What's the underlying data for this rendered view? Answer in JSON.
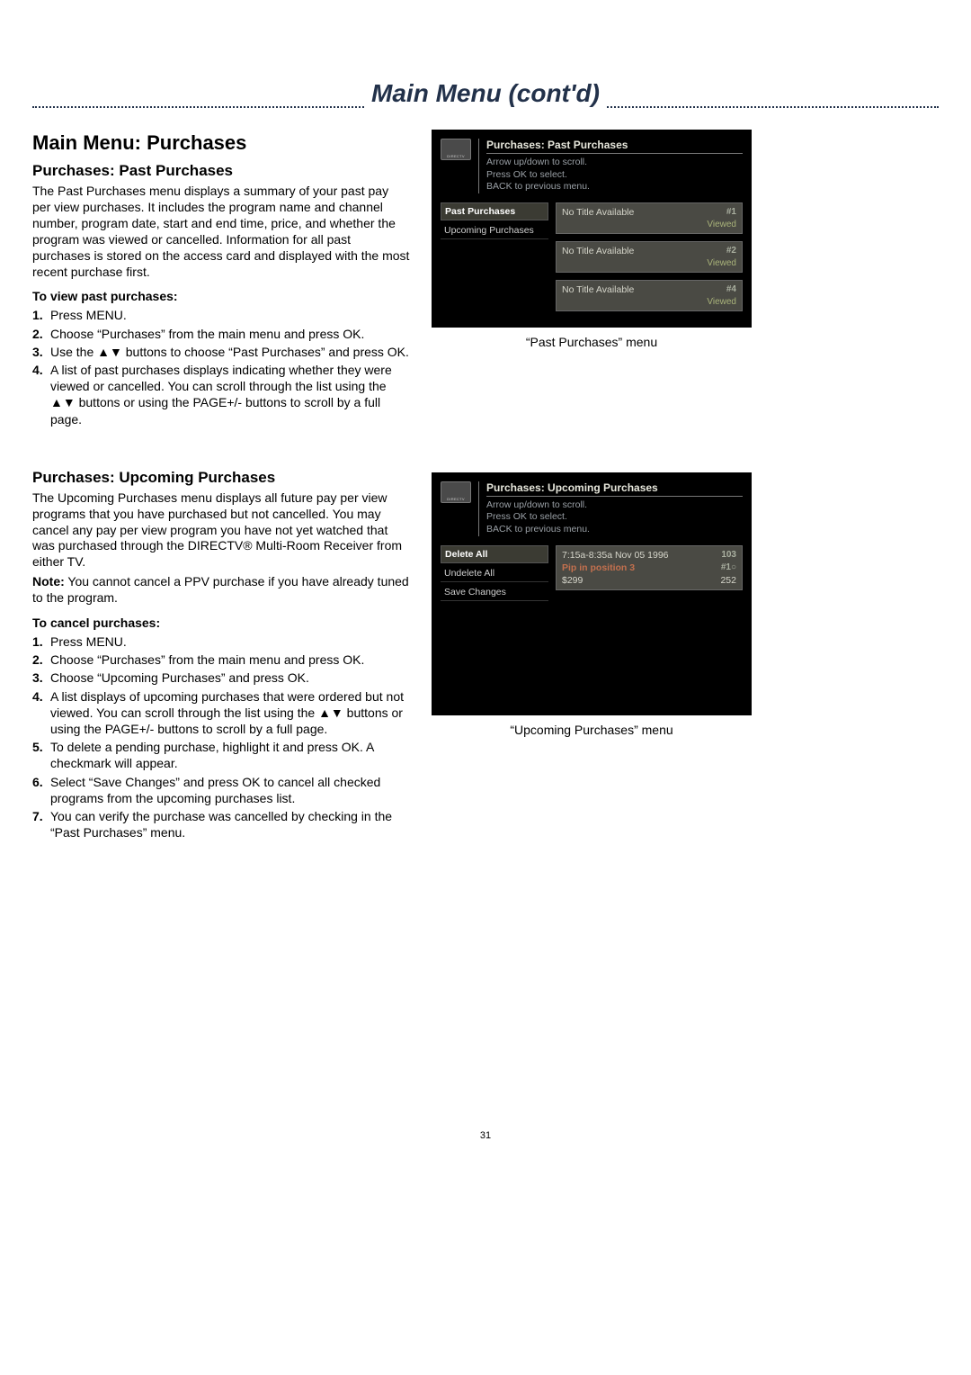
{
  "page_title": "Main Menu (cont'd)",
  "page_number": "31",
  "section1": {
    "heading": "Main Menu: Purchases",
    "sub": "Purchases: Past Purchases",
    "para": "The Past Purchases menu displays a summary of your past pay per view purchases. It includes the program name and channel number, program date, start and end time, price, and whether the program was viewed or cancelled. Information for all past purchases is stored on the access card and displayed with the most recent purchase first.",
    "howto_label": "To view past purchases:",
    "steps": [
      "Press MENU.",
      "Choose “Purchases” from the main menu and press OK.",
      "Use the ▲▼ buttons to choose “Past Purchases” and press OK.",
      "A list of past purchases displays indicating whether they were viewed or cancelled. You can scroll through the list using the ▲▼ buttons or using the PAGE+/- buttons to scroll by a full page."
    ],
    "screenshot": {
      "title": "Purchases: Past Purchases",
      "hints": [
        "Arrow up/down to scroll.",
        "Press OK to select.",
        "BACK to previous menu."
      ],
      "sidebar": [
        "Past Purchases",
        "Upcoming Purchases"
      ],
      "cards": [
        {
          "title": "No Title Available",
          "badge": "#1",
          "status": "Viewed"
        },
        {
          "title": "No Title Available",
          "badge": "#2",
          "status": "Viewed"
        },
        {
          "title": "No Title Available",
          "badge": "#4",
          "status": "Viewed"
        }
      ],
      "caption": "“Past Purchases” menu"
    }
  },
  "section2": {
    "sub": "Purchases: Upcoming Purchases",
    "para": "The Upcoming Purchases menu displays all future pay per view programs that you have purchased but not cancelled. You may cancel any pay per view program you have not yet watched that was purchased through the DIRECTV® Multi-Room Receiver from either TV.",
    "note_label": "Note:",
    "note_text": " You cannot cancel a PPV purchase if you have already tuned to the program.",
    "howto_label": "To cancel purchases:",
    "steps": [
      "Press MENU.",
      "Choose “Purchases” from the main menu and press OK.",
      "Choose “Upcoming Purchases” and press OK.",
      "A list displays of upcoming purchases that were ordered but not viewed. You can scroll through the list using the ▲▼ buttons or using the PAGE+/- buttons to scroll by a full page.",
      "To delete a pending purchase, highlight it and press OK. A checkmark will appear.",
      "Select “Save Changes” and press OK to cancel all checked programs from the upcoming purchases list.",
      "You can verify the purchase was cancelled by checking in the “Past Purchases” menu."
    ],
    "screenshot": {
      "title": "Purchases: Upcoming Purchases",
      "hints": [
        "Arrow up/down to scroll.",
        "Press OK to select.",
        "BACK to previous menu."
      ],
      "sidebar": [
        "Delete All",
        "Undelete All",
        "Save Changes"
      ],
      "card": {
        "line1_left": "7:15a-8:35a Nov 05 1996",
        "line1_right": "103",
        "line2_left": "Pip in position 3",
        "line2_right": "#1○",
        "line3_left": "$299",
        "line3_right": "252"
      },
      "caption": "“Upcoming Purchases” menu"
    }
  }
}
